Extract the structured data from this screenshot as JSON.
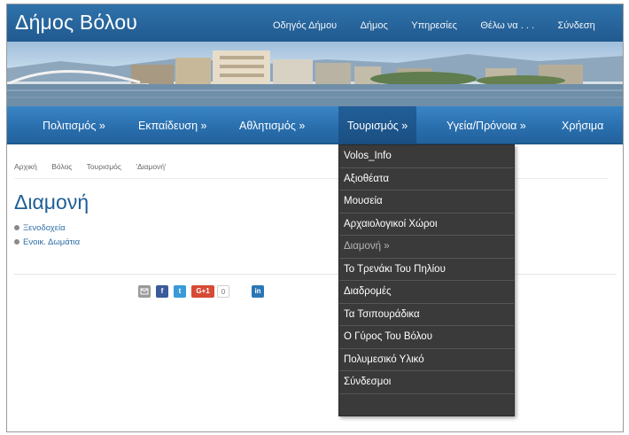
{
  "header": {
    "site_title": "Δήμος Βόλου",
    "top_links": [
      "Οδηγός Δήμου",
      "Δήμος",
      "Υπηρεσίες",
      "Θέλω να . . .",
      "Σύνδεση"
    ]
  },
  "main_nav": [
    {
      "label": "Πολιτισμός »"
    },
    {
      "label": "Εκπαίδευση »"
    },
    {
      "label": "Αθλητισμός »"
    },
    {
      "label": "Τουρισμός »"
    },
    {
      "label": "Υγεία/Πρόνοια »"
    },
    {
      "label": "Χρήσιμα"
    }
  ],
  "breadcrumb": [
    "Αρχική",
    "Βόλος",
    "Τουρισμός",
    "'Διαμονή'"
  ],
  "page": {
    "title": "Διαμονή",
    "sublinks": [
      "Ξενοδοχεία",
      "Ενοικ. Δωμάτια"
    ]
  },
  "social": {
    "gplus_label": "G+1",
    "gplus_count": "0"
  },
  "dropdown": {
    "items": [
      "Volos_Info",
      "Αξιοθέατα",
      "Μουσεία",
      "Αρχαιολογικοί Χώροι",
      "Διαμονή »",
      "Το Τρενάκι Του Πηλίου",
      "Διαδρομές",
      "Τα Τσιπουράδικα",
      "Ο Γύρος Του Βόλου",
      "Πολυμεσικό Υλικό",
      "Σύνδεσμοι"
    ]
  },
  "colors": {
    "brand_blue": "#2a6fae",
    "dropdown_bg": "#3a3a3a"
  }
}
